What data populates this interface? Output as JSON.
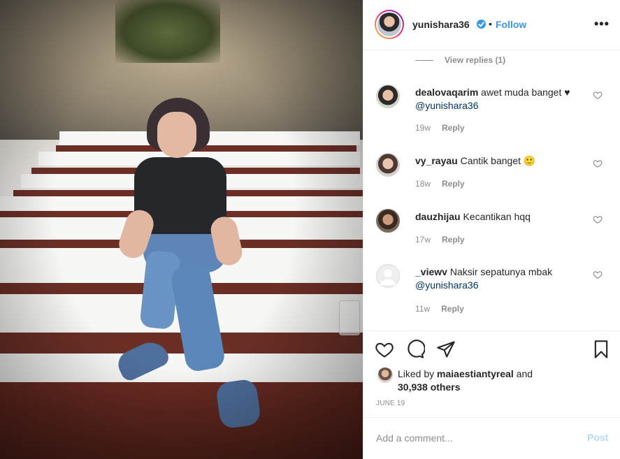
{
  "post": {
    "header": {
      "username": "yunishara36",
      "separator": "•",
      "follow_label": "Follow",
      "more_label": "•••"
    },
    "view_replies": "View replies (1)",
    "comments": [
      {
        "username": "dealovaqarim",
        "text": "awet muda banget ♥",
        "mention": "@yunishara36",
        "time": "19w",
        "reply_label": "Reply"
      },
      {
        "username": "vy_rayau",
        "text": "Cantik banget 🙂",
        "mention": "",
        "time": "18w",
        "reply_label": "Reply"
      },
      {
        "username": "dauzhijau",
        "text": "Kecantikan hqq",
        "mention": "",
        "time": "17w",
        "reply_label": "Reply"
      },
      {
        "username": "_viewv",
        "text": "Naksir sepatunya mbak",
        "mention": "@yunishara36",
        "time": "11w",
        "reply_label": "Reply"
      }
    ],
    "likes": {
      "prefix": "Liked by",
      "user": "maiaestiantyreal",
      "connector": "and",
      "others": "30,938 others"
    },
    "date": "JUNE 19",
    "add_comment": {
      "placeholder": "Add a comment...",
      "post_label": "Post"
    }
  },
  "colors": {
    "accent": "#3897f0",
    "post_disabled": "#b3dbff",
    "mention": "#003569",
    "meta": "#8e8e8e"
  },
  "icons": [
    "heart-icon",
    "comment-icon",
    "share-icon",
    "bookmark-icon",
    "verified-badge-icon",
    "more-options-icon"
  ]
}
